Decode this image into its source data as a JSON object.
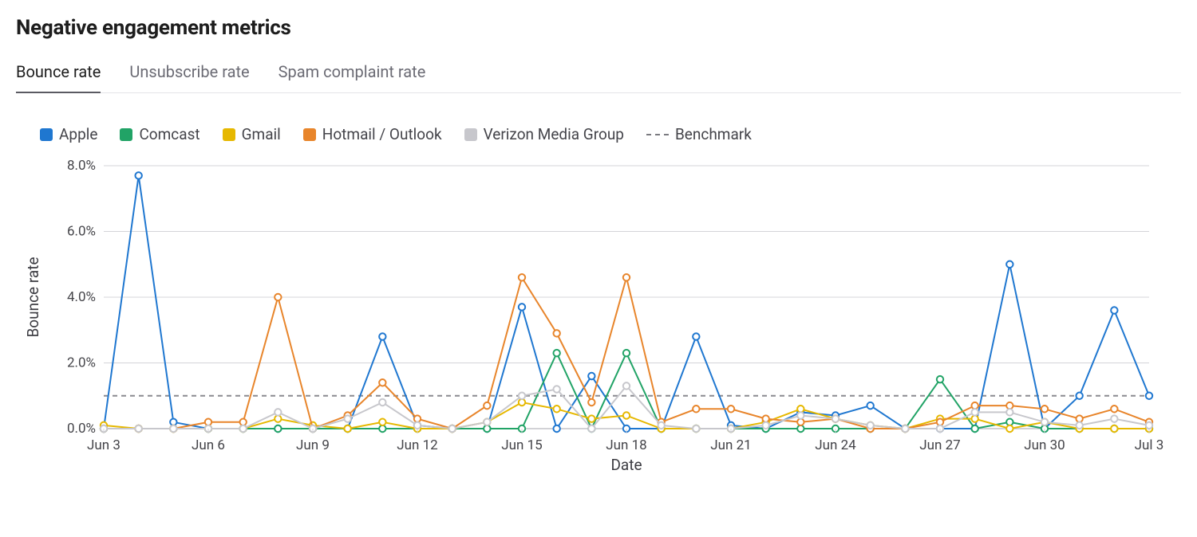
{
  "title": "Negative engagement metrics",
  "tabs": [
    {
      "id": "bounce",
      "label": "Bounce rate",
      "active": true
    },
    {
      "id": "unsub",
      "label": "Unsubscribe rate",
      "active": false
    },
    {
      "id": "spam",
      "label": "Spam complaint rate",
      "active": false
    }
  ],
  "legend": [
    {
      "name": "Apple",
      "color": "#1f77d0"
    },
    {
      "name": "Comcast",
      "color": "#21a366"
    },
    {
      "name": "Gmail",
      "color": "#e6b800"
    },
    {
      "name": "Hotmail / Outlook",
      "color": "#e8852b"
    },
    {
      "name": "Verizon Media Group",
      "color": "#c7c7cc"
    },
    {
      "name": "Benchmark",
      "style": "dashed"
    }
  ],
  "chart_data": {
    "type": "line",
    "title": "Negative engagement metrics",
    "xlabel": "Date",
    "ylabel": "Bounce rate",
    "ylim": [
      0,
      8
    ],
    "ytick_labels": [
      "0.0%",
      "2.0%",
      "4.0%",
      "6.0%",
      "8.0%"
    ],
    "yticks": [
      0,
      2,
      4,
      6,
      8
    ],
    "x": [
      "Jun 3",
      "Jun 4",
      "Jun 5",
      "Jun 6",
      "Jun 7",
      "Jun 8",
      "Jun 9",
      "Jun 10",
      "Jun 11",
      "Jun 12",
      "Jun 13",
      "Jun 14",
      "Jun 15",
      "Jun 16",
      "Jun 17",
      "Jun 18",
      "Jun 19",
      "Jun 20",
      "Jun 21",
      "Jun 22",
      "Jun 23",
      "Jun 24",
      "Jun 25",
      "Jun 26",
      "Jun 27",
      "Jun 28",
      "Jun 29",
      "Jun 30",
      "Jul 1",
      "Jul 2",
      "Jul 3"
    ],
    "xtick_indices": [
      0,
      3,
      6,
      9,
      12,
      15,
      18,
      21,
      24,
      27,
      30
    ],
    "benchmark": 1.0,
    "series": [
      {
        "name": "Apple",
        "color": "#1f77d0",
        "values": [
          0.0,
          7.7,
          0.2,
          0.0,
          0.0,
          0.0,
          0.0,
          0.0,
          2.8,
          0.1,
          0.0,
          0.0,
          3.7,
          0.0,
          1.6,
          0.0,
          0.0,
          2.8,
          0.1,
          0.0,
          0.5,
          0.4,
          0.7,
          0.0,
          0.0,
          0.0,
          5.0,
          0.0,
          1.0,
          3.6,
          1.0
        ]
      },
      {
        "name": "Comcast",
        "color": "#21a366",
        "values": [
          0.0,
          0.0,
          0.0,
          0.0,
          0.0,
          0.0,
          0.0,
          0.0,
          0.0,
          0.0,
          0.0,
          0.0,
          0.0,
          2.3,
          0.0,
          2.3,
          0.0,
          0.0,
          0.0,
          0.0,
          0.0,
          0.0,
          0.0,
          0.0,
          1.5,
          0.0,
          0.2,
          0.0,
          0.0,
          0.0,
          0.0
        ]
      },
      {
        "name": "Gmail",
        "color": "#e6b800",
        "values": [
          0.1,
          0.0,
          0.0,
          0.0,
          0.0,
          0.3,
          0.1,
          0.0,
          0.2,
          0.0,
          0.0,
          0.2,
          0.8,
          0.6,
          0.3,
          0.4,
          0.0,
          0.0,
          0.0,
          0.2,
          0.6,
          0.3,
          0.1,
          0.0,
          0.3,
          0.3,
          0.0,
          0.2,
          0.0,
          0.0,
          0.0
        ]
      },
      {
        "name": "Hotmail / Outlook",
        "color": "#e8852b",
        "values": [
          0.0,
          0.0,
          0.0,
          0.2,
          0.2,
          4.0,
          0.0,
          0.4,
          1.4,
          0.3,
          0.0,
          0.7,
          4.6,
          2.9,
          0.8,
          4.6,
          0.2,
          0.6,
          0.6,
          0.3,
          0.2,
          0.3,
          0.0,
          0.0,
          0.2,
          0.7,
          0.7,
          0.6,
          0.3,
          0.6,
          0.2
        ]
      },
      {
        "name": "Verizon Media Group",
        "color": "#c7c7cc",
        "values": [
          0.0,
          0.0,
          0.0,
          0.0,
          0.0,
          0.5,
          0.0,
          0.3,
          0.8,
          0.1,
          0.0,
          0.2,
          1.0,
          1.2,
          0.0,
          1.3,
          0.1,
          0.0,
          0.0,
          0.1,
          0.4,
          0.3,
          0.1,
          0.0,
          0.0,
          0.5,
          0.5,
          0.2,
          0.1,
          0.3,
          0.1
        ]
      }
    ]
  }
}
